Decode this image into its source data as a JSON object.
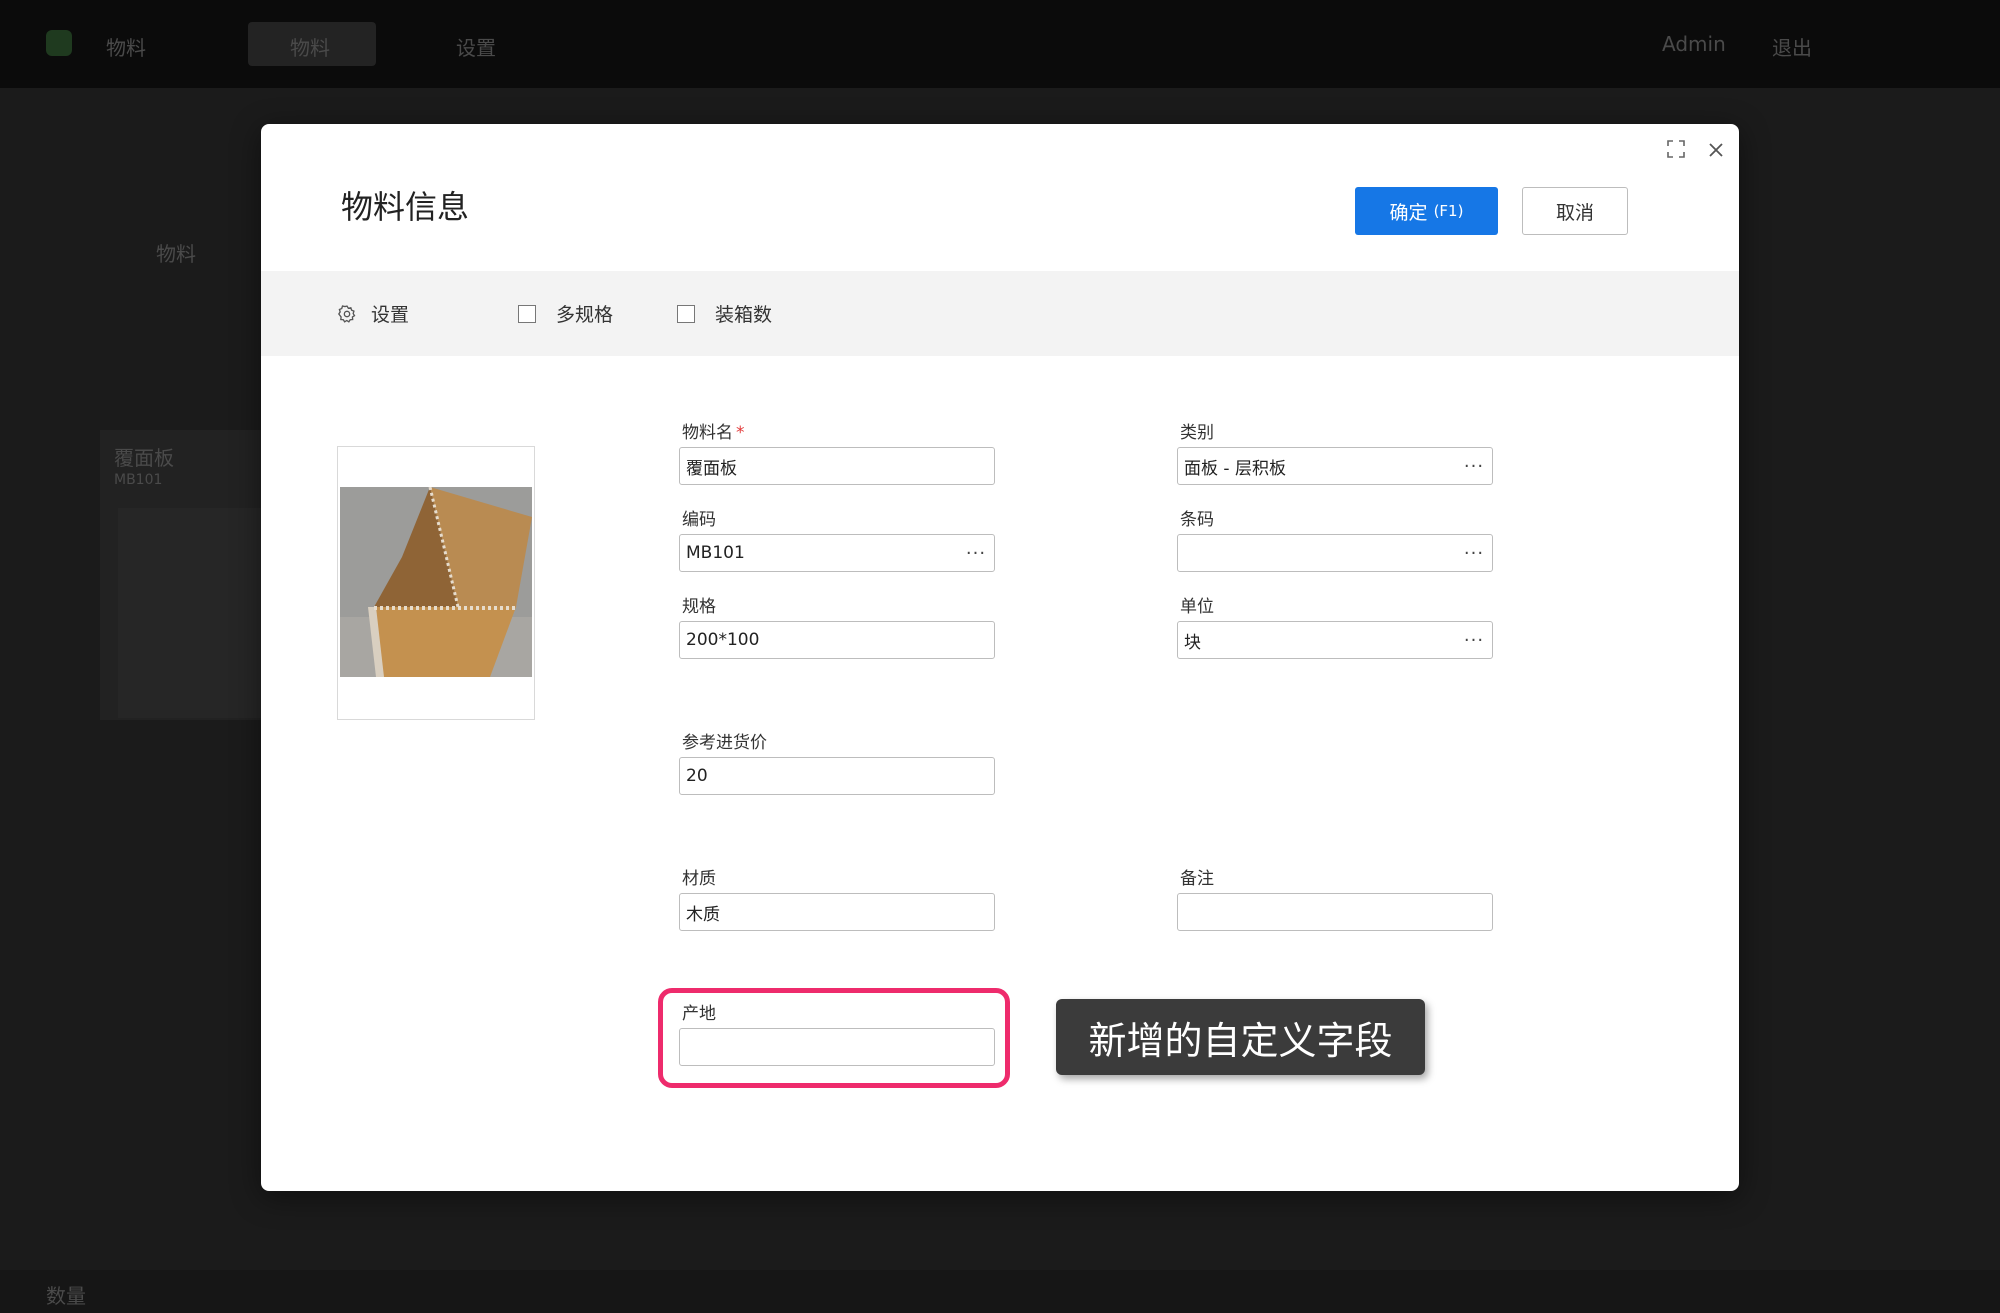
{
  "app": {
    "brand": "物料",
    "nav": [
      "物料",
      "设置"
    ],
    "user": "Admin",
    "logout": "退出",
    "list_header": "物料",
    "card_title": "覆面板",
    "card_sub": "MB101",
    "bottom_left": "数量"
  },
  "modal": {
    "title": "物料信息",
    "confirm_label": "确定",
    "confirm_hotkey": "(F1)",
    "cancel_label": "取消"
  },
  "toolbar": {
    "settings_label": "设置",
    "multi_spec_label": "多规格",
    "packing_label": "装箱数"
  },
  "form": {
    "name": {
      "label": "物料名",
      "required_mark": "*",
      "value": "覆面板"
    },
    "category": {
      "label": "类别",
      "value": "面板 - 层积板"
    },
    "code": {
      "label": "编码",
      "value": "MB101"
    },
    "barcode": {
      "label": "条码",
      "value": ""
    },
    "spec": {
      "label": "规格",
      "value": "200*100"
    },
    "unit": {
      "label": "单位",
      "value": "块"
    },
    "ref_price": {
      "label": "参考进货价",
      "value": "20"
    },
    "material": {
      "label": "材质",
      "value": "木质"
    },
    "remark": {
      "label": "备注",
      "value": ""
    },
    "origin": {
      "label": "产地",
      "value": ""
    }
  },
  "annotation": {
    "tooltip": "新增的自定义字段",
    "highlight_color": "#ee2b6c"
  },
  "colors": {
    "primary": "#1677e6",
    "backdrop": "#1b1b1b"
  }
}
